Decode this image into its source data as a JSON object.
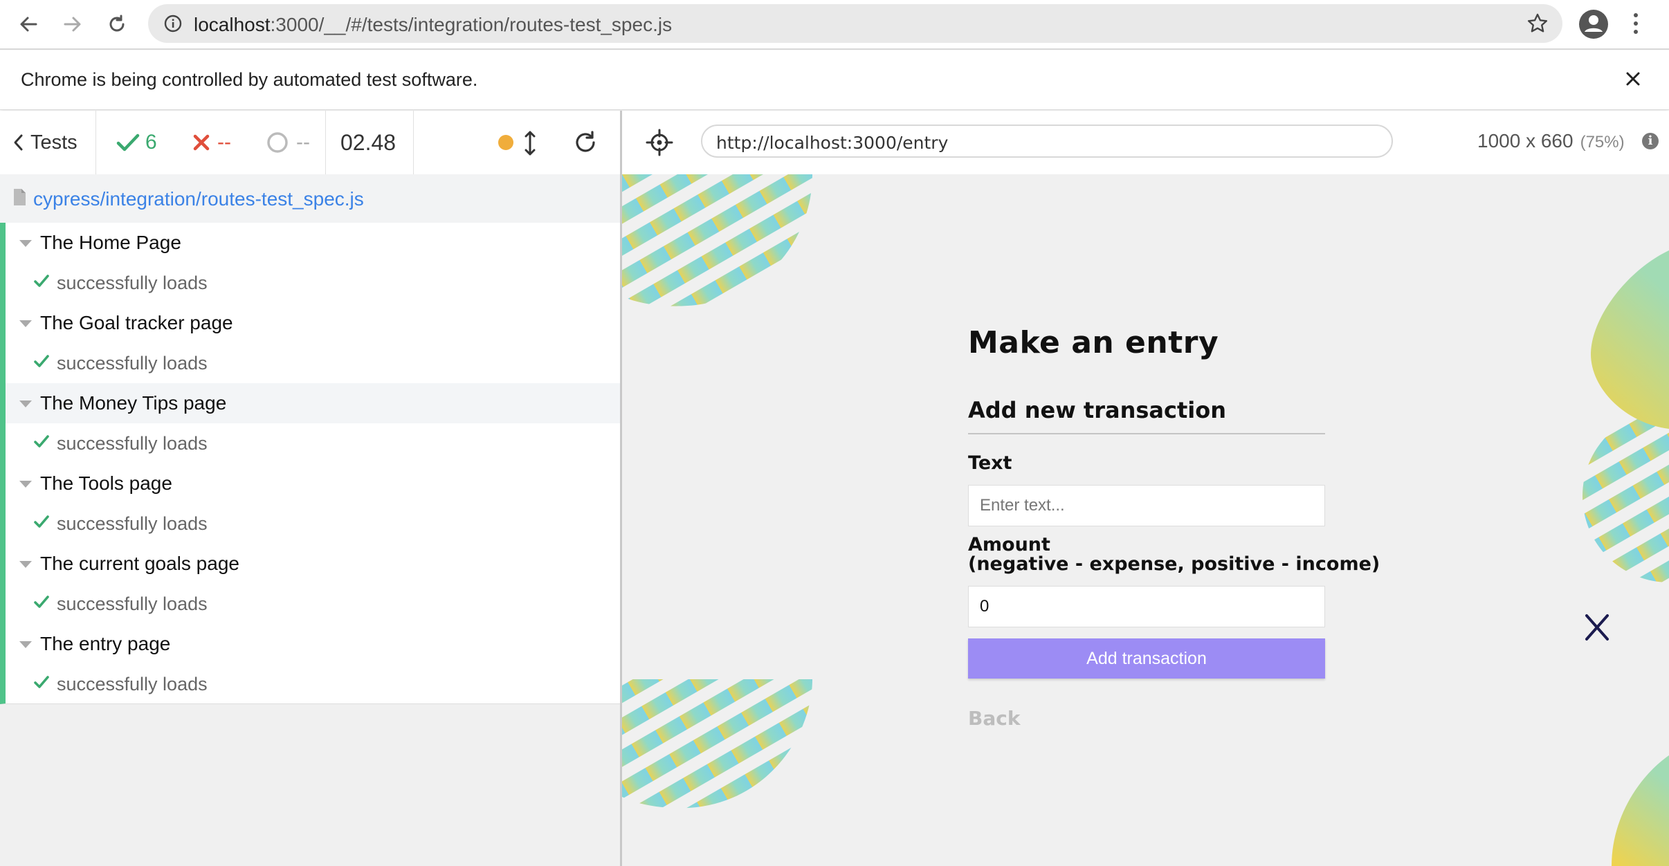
{
  "browser": {
    "url_host": "localhost",
    "url_rest": ":3000/__/#/tests/integration/routes-test_spec.js",
    "banner_text": "Chrome is being controlled by automated test software."
  },
  "runner": {
    "tests_label": "Tests",
    "passed_count": "6",
    "failed_count": "--",
    "pending_count": "--",
    "duration": "02.48",
    "spec_path": "cypress/integration/routes-test_spec.js",
    "suites": [
      {
        "title": "The Home Page",
        "test": "successfully loads"
      },
      {
        "title": "The Goal tracker page",
        "test": "successfully loads"
      },
      {
        "title": "The Money Tips page",
        "test": "successfully loads"
      },
      {
        "title": "The Tools page",
        "test": "successfully loads"
      },
      {
        "title": "The current goals page",
        "test": "successfully loads"
      },
      {
        "title": "The entry page",
        "test": "successfully loads"
      }
    ]
  },
  "aut": {
    "url": "http://localhost:3000/entry",
    "viewport": "1000 x 660",
    "scale": "(75%)",
    "page_title": "Make an entry",
    "section_title": "Add new transaction",
    "text_label": "Text",
    "text_placeholder": "Enter text...",
    "amount_label_line1": "Amount",
    "amount_label_line2": "(negative - expense, positive - income)",
    "amount_value": "0",
    "add_button": "Add transaction",
    "back_link": "Back"
  },
  "colors": {
    "pass": "#3aa96f",
    "fail": "#e04e3b",
    "running": "#f0ad3b",
    "accent_button": "#9c8cf4",
    "link": "#3b82e6"
  }
}
